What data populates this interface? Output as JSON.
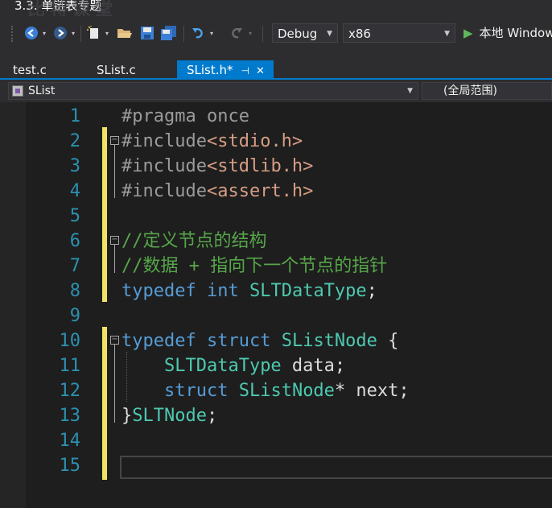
{
  "window": {
    "title": "3.3. 单链表专题",
    "watermark": "比特课堂"
  },
  "toolbar": {
    "config": "Debug",
    "platform": "x86",
    "run_label": "本地 Window"
  },
  "tabs": [
    {
      "label": "test.c",
      "active": false
    },
    {
      "label": "SList.c",
      "active": false
    },
    {
      "label": "SList.h*",
      "active": true
    }
  ],
  "navbar": {
    "scope_left": "SList",
    "scope_right": "(全局范围)"
  },
  "editor": {
    "lines": [
      {
        "n": "1"
      },
      {
        "n": "2"
      },
      {
        "n": "3"
      },
      {
        "n": "4"
      },
      {
        "n": "5"
      },
      {
        "n": "6"
      },
      {
        "n": "7"
      },
      {
        "n": "8"
      },
      {
        "n": "9"
      },
      {
        "n": "10"
      },
      {
        "n": "11"
      },
      {
        "n": "12"
      },
      {
        "n": "13"
      },
      {
        "n": "14"
      },
      {
        "n": "15"
      }
    ],
    "code": {
      "l1_pp": "#pragma once",
      "l2_pp": "#include",
      "l2_file": "<stdio.h>",
      "l3_pp": "#include",
      "l3_file": "<stdlib.h>",
      "l4_pp": "#include",
      "l4_file": "<assert.h>",
      "l6_comment": "//定义节点的结构",
      "l7_comment": "//数据 + 指向下一个节点的指针",
      "l8_kw1": "typedef",
      "l8_kw2": "int",
      "l8_type": "SLTDataType",
      "l8_end": ";",
      "l10_kw1": "typedef",
      "l10_kw2": "struct",
      "l10_type": "SListNode",
      "l10_brace": " {",
      "l11_type": "SLTDataType",
      "l11_rest": " data;",
      "l12_kw": "struct",
      "l12_type": "SListNode",
      "l12_rest": "* next;",
      "l13_brace": "}",
      "l13_type": "SLTNode",
      "l13_end": ";"
    }
  }
}
